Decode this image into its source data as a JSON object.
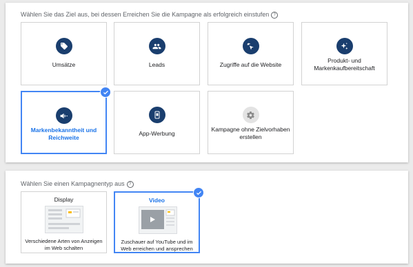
{
  "goals_section": {
    "prompt": "Wählen Sie das Ziel aus, bei dessen Erreichen Sie die Kampagne als erfolgreich einstufen",
    "help_icon": "?",
    "cards": [
      {
        "label": "Umsätze",
        "icon": "tag-icon",
        "selected": false
      },
      {
        "label": "Leads",
        "icon": "people-icon",
        "selected": false
      },
      {
        "label": "Zugriffe auf die Website",
        "icon": "cursor-click-icon",
        "selected": false
      },
      {
        "label": "Produkt- und Markenkaufbereitschaft",
        "icon": "sparkle-icon",
        "selected": false
      },
      {
        "label": "Markenbekanntheit und Reichweite",
        "icon": "megaphone-icon",
        "selected": true
      },
      {
        "label": "App-Werbung",
        "icon": "phone-icon",
        "selected": false
      },
      {
        "label": "Kampagne ohne Zielvorhaben erstellen",
        "icon": "gear-icon",
        "selected": false
      }
    ]
  },
  "type_section": {
    "prompt": "Wählen Sie einen Kampagnentyp aus",
    "help_icon": "?",
    "cards": [
      {
        "title": "Display",
        "description": "Verschiedene Arten von Anzeigen im Web schalten",
        "icon": "display-ad-illustration",
        "selected": false
      },
      {
        "title": "Video",
        "description": "Zuschauer auf YouTube und im Web erreichen und ansprechen",
        "icon": "video-player-illustration",
        "selected": true
      }
    ]
  },
  "colors": {
    "accent": "#4285f4",
    "accent_text": "#1a73e8",
    "icon_bg": "#1a3e6e",
    "icon_bg_disabled": "#e3e3e3"
  }
}
